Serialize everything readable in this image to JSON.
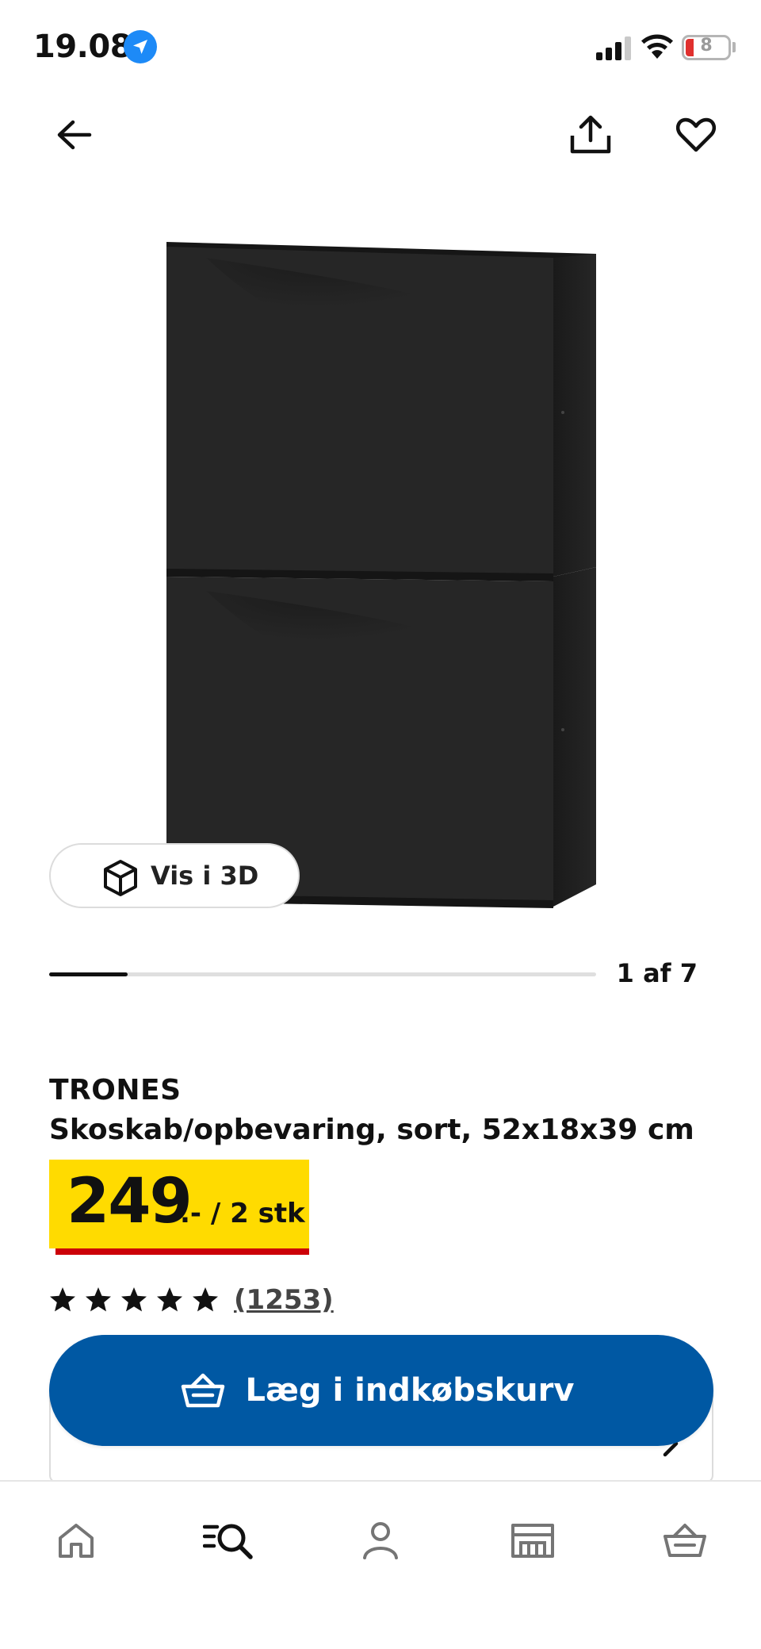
{
  "status_bar": {
    "time": "19.08",
    "battery_level": "8",
    "icons": [
      "location-arrow-icon",
      "cellular-signal-icon",
      "wifi-icon",
      "battery-icon"
    ]
  },
  "top_nav": {
    "icons": [
      "arrow-left-icon",
      "share-icon",
      "heart-icon"
    ]
  },
  "gallery": {
    "view_3d_label": "Vis i 3D",
    "pager_label": "1 af 7",
    "pager_progress": 0.143
  },
  "product": {
    "name": "TRONES",
    "description": "Skoskab/opbevaring, sort, 52x18x39 cm",
    "price_main": "249",
    "price_suffix": ".- / 2 stk",
    "rating_stars": 5,
    "review_count": "(1253)"
  },
  "cta": {
    "add_to_cart_label": "Læg i indkøbskurv"
  },
  "colors": {
    "primary_blue": "#0058a3",
    "price_yellow": "#ffdb00",
    "price_red": "#cc0008",
    "location_blue": "#1d8af7"
  },
  "bottom_nav": {
    "items": [
      "home-icon",
      "search-list-icon",
      "profile-icon",
      "store-icon",
      "basket-icon"
    ]
  }
}
